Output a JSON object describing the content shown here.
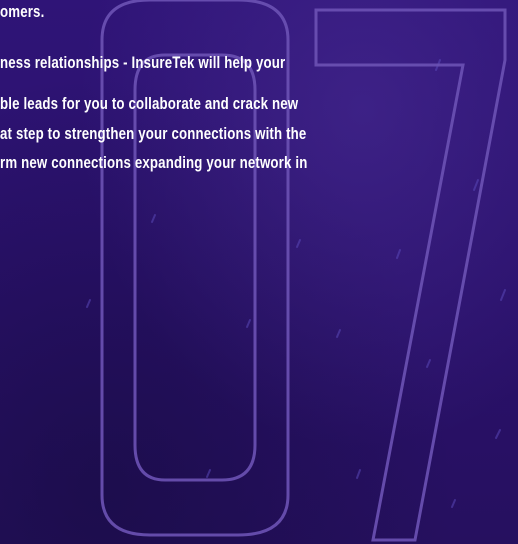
{
  "page": {
    "section_number": "07",
    "accent_color": "#2b1270",
    "outline_color": "#6c52b4"
  },
  "paragraph": {
    "line0": "omers.",
    "line1": "ness  relationships  -  InsureTek  will  help  your",
    "line2": "ble leads for you to collaborate and crack new",
    "line3": "at step to strengthen your connections with the",
    "line4": "rm new connections expanding your network in"
  }
}
